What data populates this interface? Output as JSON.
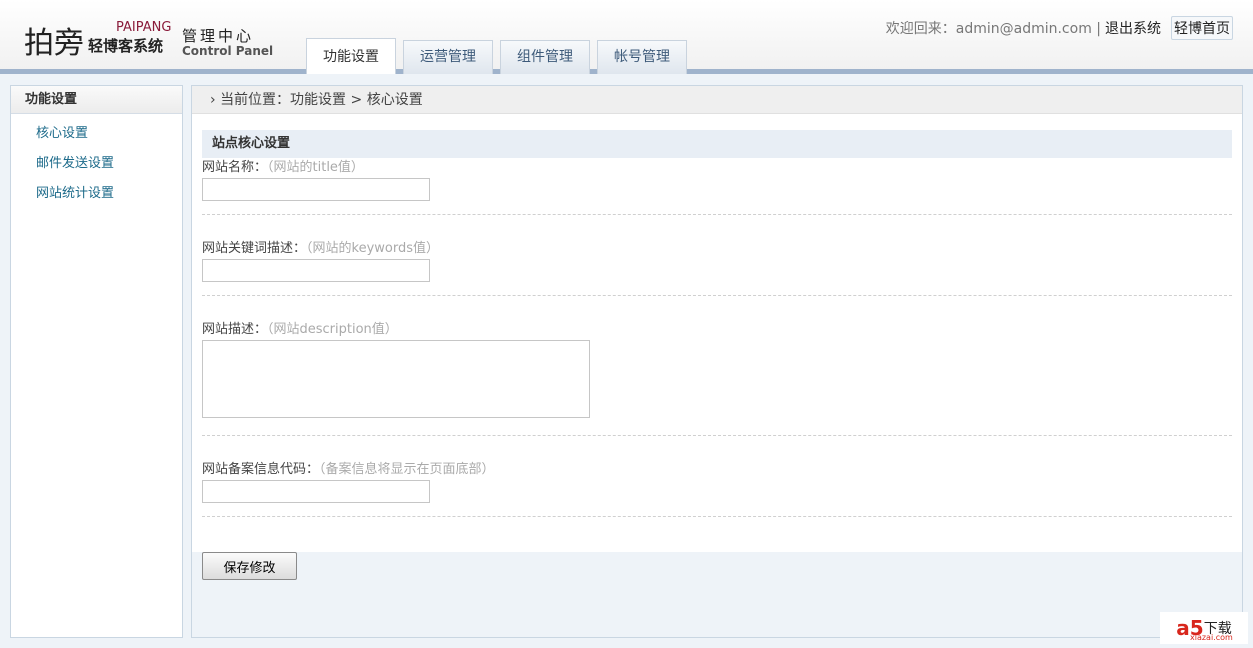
{
  "header": {
    "logo_main": "拍旁",
    "logo_sub": "轻博客系统",
    "logo_brand": "PAIPANG",
    "logo_center": "管理中心",
    "logo_panel": "Control Panel",
    "tabs": [
      {
        "label": "功能设置"
      },
      {
        "label": "运营管理"
      },
      {
        "label": "组件管理"
      },
      {
        "label": "帐号管理"
      }
    ],
    "welcome": "欢迎回来：admin@admin.com |",
    "logout": "退出系统",
    "home": "轻博首页"
  },
  "sidebar": {
    "title": "功能设置",
    "items": [
      {
        "label": "核心设置"
      },
      {
        "label": "邮件发送设置"
      },
      {
        "label": "网站统计设置"
      }
    ]
  },
  "main": {
    "breadcrumb": "当前位置：功能设置 > 核心设置",
    "section_title": "站点核心设置",
    "fields": [
      {
        "label": "网站名称：",
        "hint": "（网站的title值）",
        "value": ""
      },
      {
        "label": "网站关键词描述：",
        "hint": "（网站的keywords值）",
        "value": ""
      },
      {
        "label": "网站描述：",
        "hint": "（网站description值）",
        "value": ""
      },
      {
        "label": "网站备案信息代码：",
        "hint": "（备案信息将显示在页面底部）",
        "value": ""
      }
    ],
    "save_label": "保存修改"
  },
  "watermark": {
    "logo": "a5",
    "text": "下载",
    "domain": "xiazai.com"
  }
}
